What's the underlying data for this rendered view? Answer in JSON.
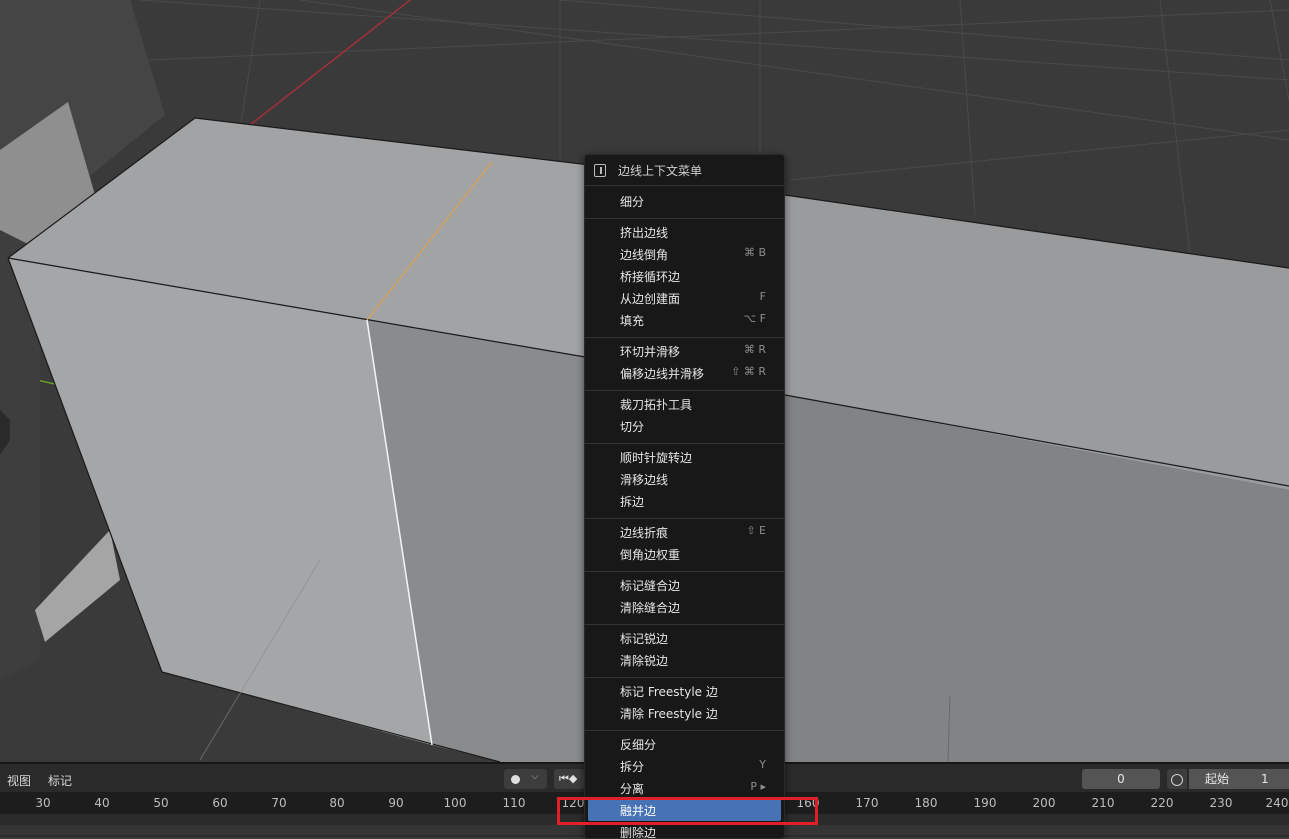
{
  "context_menu": {
    "title": "边线上下文菜单",
    "items": [
      {
        "label": "细分",
        "shortcut": ""
      },
      {
        "label": "挤出边线",
        "shortcut": ""
      },
      {
        "label": "边线倒角",
        "shortcut": "⌘ B"
      },
      {
        "label": "桥接循环边",
        "shortcut": ""
      },
      {
        "label": "从边创建面",
        "shortcut": "F"
      },
      {
        "label": "填充",
        "shortcut": "⌥ F"
      },
      {
        "label": "环切并滑移",
        "shortcut": "⌘ R"
      },
      {
        "label": "偏移边线并滑移",
        "shortcut": "⇧ ⌘ R"
      },
      {
        "label": "裁刀拓扑工具",
        "shortcut": ""
      },
      {
        "label": "切分",
        "shortcut": ""
      },
      {
        "label": "顺时针旋转边",
        "shortcut": ""
      },
      {
        "label": "滑移边线",
        "shortcut": ""
      },
      {
        "label": "拆边",
        "shortcut": ""
      },
      {
        "label": "边线折痕",
        "shortcut": "⇧ E"
      },
      {
        "label": "倒角边权重",
        "shortcut": ""
      },
      {
        "label": "标记缝合边",
        "shortcut": ""
      },
      {
        "label": "清除缝合边",
        "shortcut": ""
      },
      {
        "label": "标记锐边",
        "shortcut": ""
      },
      {
        "label": "清除锐边",
        "shortcut": ""
      },
      {
        "label": "标记 Freestyle 边",
        "shortcut": ""
      },
      {
        "label": "清除 Freestyle 边",
        "shortcut": ""
      },
      {
        "label": "反细分",
        "shortcut": ""
      },
      {
        "label": "拆分",
        "shortcut": "Y"
      },
      {
        "label": "分离",
        "shortcut": "P ▸"
      },
      {
        "label": "融并边",
        "shortcut": ""
      },
      {
        "label": "删除边",
        "shortcut": ""
      }
    ],
    "highlighted_item": "融并边"
  },
  "timeline": {
    "menu": {
      "view": "视图",
      "marker": "标记"
    },
    "current_frame": "0",
    "start_label": "起始",
    "start_value": "1",
    "ruler_ticks": [
      "30",
      "40",
      "50",
      "60",
      "70",
      "80",
      "90",
      "100",
      "110",
      "120",
      "160",
      "170",
      "180",
      "190",
      "200",
      "210",
      "220",
      "230",
      "240"
    ]
  },
  "colors": {
    "menu_bg": "#181818",
    "highlight": "#4772b3",
    "annotation_red": "#e31e26",
    "selected_edge": "#e0a050"
  },
  "icons": {
    "menu_header": "edge-menu-icon",
    "record": "record-dot-icon",
    "skip_start": "jump-to-start-icon",
    "timer": "stopwatch-icon"
  }
}
